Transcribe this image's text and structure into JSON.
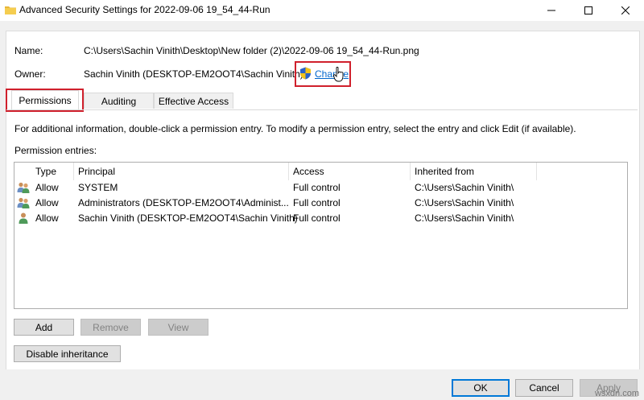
{
  "window": {
    "title": "Advanced Security Settings for 2022-09-06 19_54_44-Run",
    "folder_icon": "folder-icon",
    "controls": [
      "minimize-icon",
      "maximize-icon",
      "close-icon"
    ]
  },
  "name_row": {
    "label": "Name:",
    "value": "C:\\Users\\Sachin Vinith\\Desktop\\New folder (2)\\2022-09-06 19_54_44-Run.png"
  },
  "owner_row": {
    "label": "Owner:",
    "value": "Sachin Vinith (DESKTOP-EM2OOT4\\Sachin Vinith)",
    "change_link": "Change",
    "shield_icon": "shield-icon"
  },
  "tabs": [
    {
      "label": "Permissions",
      "active": true
    },
    {
      "label": "Auditing",
      "active": false
    },
    {
      "label": "Effective Access",
      "active": false
    }
  ],
  "info_text": "For additional information, double-click a permission entry. To modify a permission entry, select the entry and click Edit (if available).",
  "entries_label": "Permission entries:",
  "table": {
    "columns": [
      "Type",
      "Principal",
      "Access",
      "Inherited from"
    ],
    "rows": [
      {
        "icon": "users-group-icon",
        "type": "Allow",
        "principal": "SYSTEM",
        "access": "Full control",
        "inherited": "C:\\Users\\Sachin Vinith\\"
      },
      {
        "icon": "users-group-icon",
        "type": "Allow",
        "principal": "Administrators (DESKTOP-EM2OOT4\\Administ...",
        "access": "Full control",
        "inherited": "C:\\Users\\Sachin Vinith\\"
      },
      {
        "icon": "user-icon",
        "type": "Allow",
        "principal": "Sachin Vinith (DESKTOP-EM2OOT4\\Sachin Vinith)",
        "access": "Full control",
        "inherited": "C:\\Users\\Sachin Vinith\\"
      }
    ]
  },
  "buttons": {
    "add": "Add",
    "remove": "Remove",
    "view": "View",
    "disable_inheritance": "Disable inheritance",
    "ok": "OK",
    "cancel": "Cancel",
    "apply": "Apply"
  },
  "watermark": "wsxdn.com",
  "colors": {
    "highlight": "#d0202c",
    "link": "#0066cc",
    "focus": "#0078d7"
  }
}
